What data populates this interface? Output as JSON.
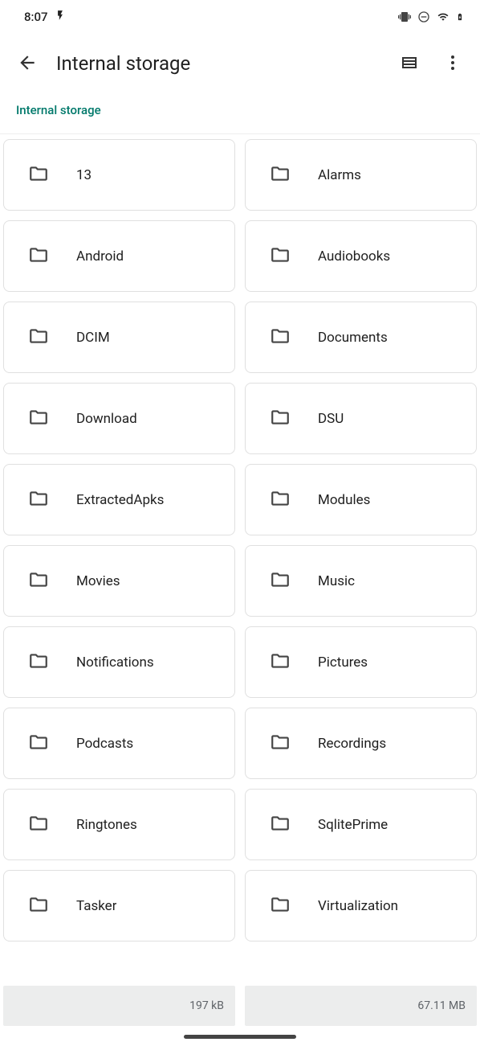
{
  "status": {
    "time": "8:07"
  },
  "appbar": {
    "title": "Internal storage"
  },
  "breadcrumb": {
    "path": "Internal storage"
  },
  "folders": [
    {
      "name": "13"
    },
    {
      "name": "Alarms"
    },
    {
      "name": "Android"
    },
    {
      "name": "Audiobooks"
    },
    {
      "name": "DCIM"
    },
    {
      "name": "Documents"
    },
    {
      "name": "Download"
    },
    {
      "name": "DSU"
    },
    {
      "name": "ExtractedApks"
    },
    {
      "name": "Modules"
    },
    {
      "name": "Movies"
    },
    {
      "name": "Music"
    },
    {
      "name": "Notifications"
    },
    {
      "name": "Pictures"
    },
    {
      "name": "Podcasts"
    },
    {
      "name": "Recordings"
    },
    {
      "name": "Ringtones"
    },
    {
      "name": "SqlitePrime"
    },
    {
      "name": "Tasker"
    },
    {
      "name": "Virtualization"
    }
  ],
  "bottom": {
    "left_size": "197 kB",
    "right_size": "67.11 MB"
  }
}
